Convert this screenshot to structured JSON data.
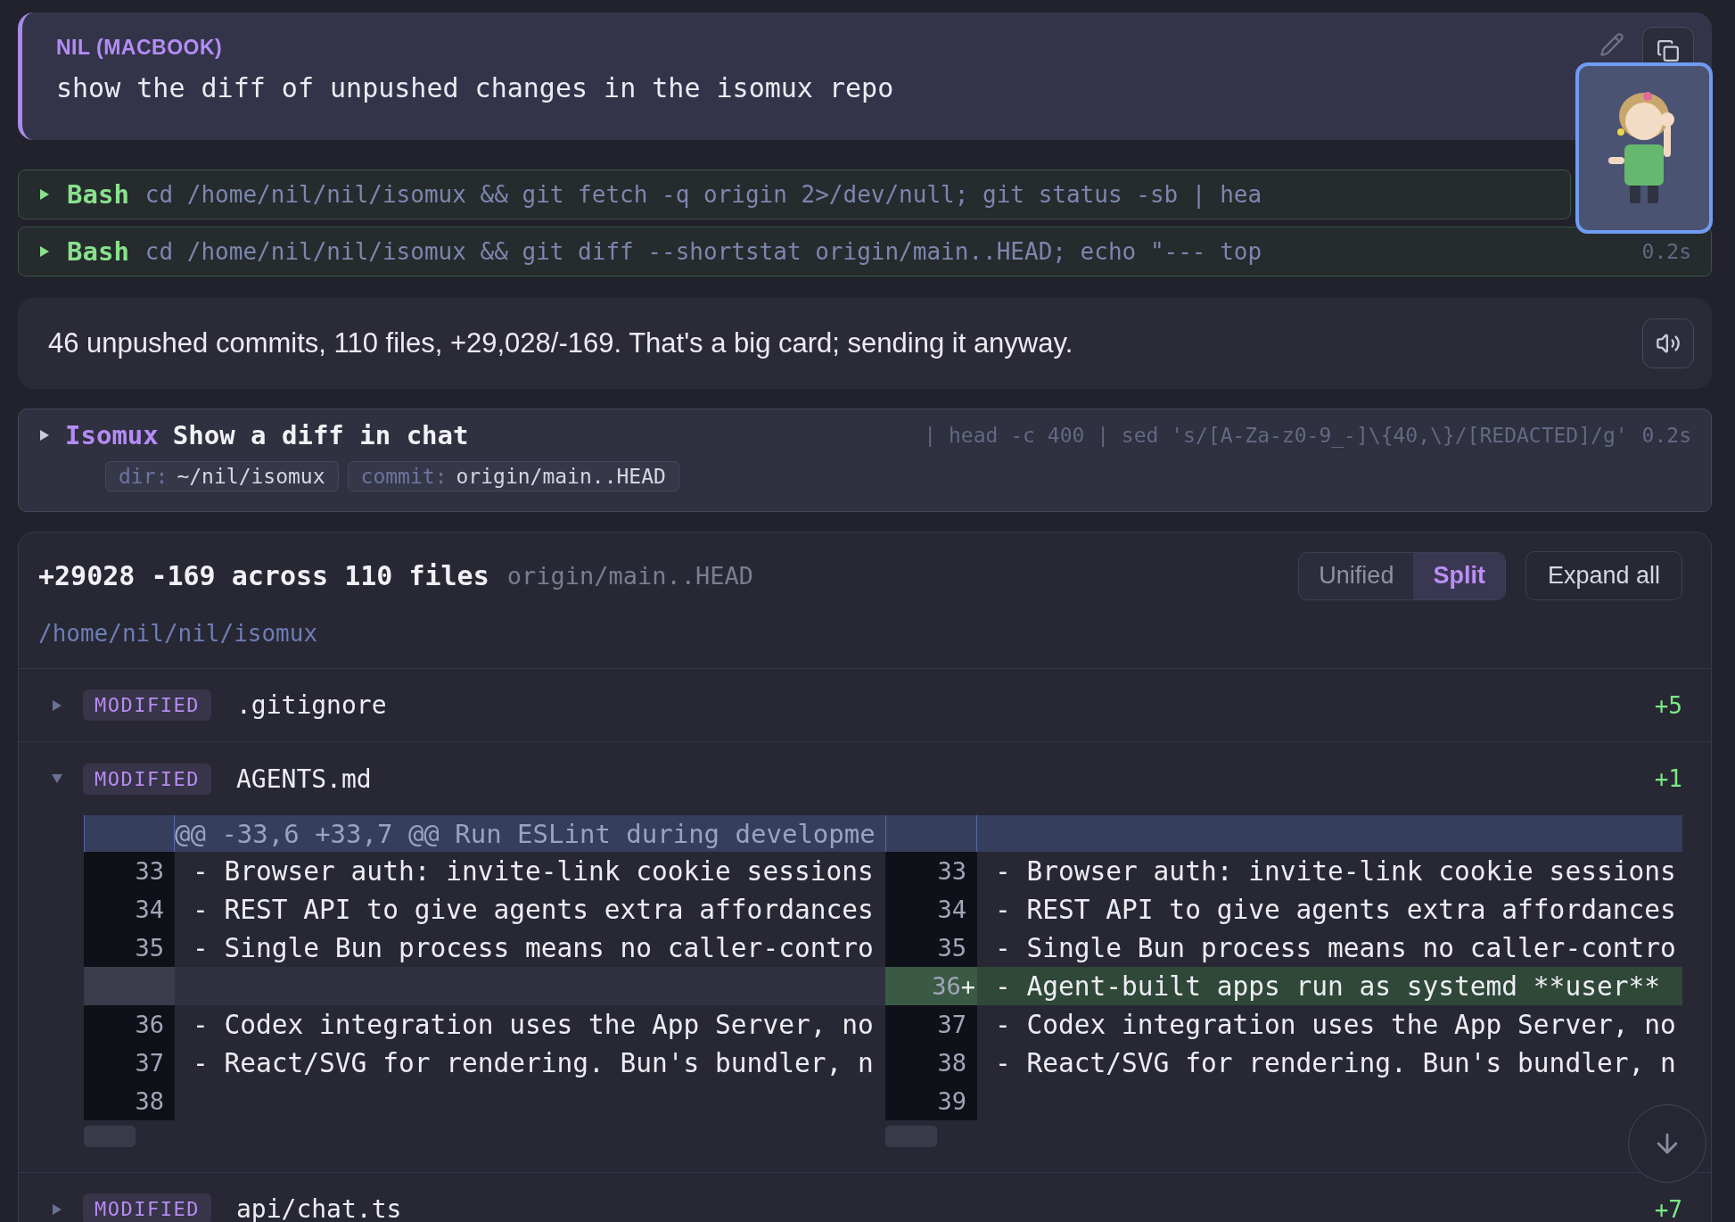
{
  "user_message": {
    "author": "NIL (MACBOOK)",
    "text": "show the diff of unpushed changes in the isomux repo"
  },
  "tool_calls": [
    {
      "tool": "Bash",
      "command": "cd /home/nil/nil/isomux && git fetch -q origin 2>/dev/null; git status -sb | hea"
    },
    {
      "tool": "Bash",
      "command": "cd /home/nil/nil/isomux && git diff --shortstat origin/main..HEAD; echo \"--- top",
      "duration": "0.2s"
    }
  ],
  "assistant_message": {
    "text": "46 unpushed commits, 110 files, +29,028/-169. That's a big card; sending it anyway."
  },
  "isomux_call": {
    "tool": "Isomux",
    "title": "Show a diff in chat",
    "command_tail": "| head -c 400 | sed 's/[A-Za-z0-9_-]\\{40,\\}/[REDACTED]/g'",
    "duration": "0.2s",
    "params": [
      {
        "key": "dir:",
        "value": "~/nil/isomux"
      },
      {
        "key": "commit:",
        "value": "origin/main..HEAD"
      }
    ]
  },
  "diff_card": {
    "stats": "+29028 -169 across 110 files",
    "range": "origin/main..HEAD",
    "path": "/home/nil/nil/isomux",
    "view_modes": [
      {
        "label": "Unified",
        "selected": false
      },
      {
        "label": "Split",
        "selected": true
      }
    ],
    "expand_button": "Expand all",
    "files": [
      {
        "status": "MODIFIED",
        "name": ".gitignore",
        "additions": "+5",
        "expanded": false
      },
      {
        "status": "MODIFIED",
        "name": "AGENTS.md",
        "additions": "+1",
        "expanded": true,
        "hunk": {
          "header": "@@ -33,6 +33,7 @@ Run ESLint during developme",
          "rows": [
            {
              "kind": "context",
              "left_number": "33",
              "left_text": "- Browser auth: invite-link cookie sessions",
              "right_number": "33",
              "right_text": "- Browser auth: invite-link cookie sessions"
            },
            {
              "kind": "context",
              "left_number": "34",
              "left_text": "- REST API to give agents extra affordances",
              "right_number": "34",
              "right_text": "- REST API to give agents extra affordances"
            },
            {
              "kind": "context",
              "left_number": "35",
              "left_text": "- Single Bun process means no caller-contro",
              "right_number": "35",
              "right_text": "- Single Bun process means no caller-contro"
            },
            {
              "kind": "added",
              "right_number": "36",
              "right_marker": "+",
              "right_text": "- Agent-built apps run as systemd **user**"
            },
            {
              "kind": "context",
              "left_number": "36",
              "left_text": "- Codex integration uses the App Server, no",
              "right_number": "37",
              "right_text": "- Codex integration uses the App Server, no"
            },
            {
              "kind": "context",
              "left_number": "37",
              "left_text": "- React/SVG for rendering. Bun's bundler, n",
              "right_number": "38",
              "right_text": "- React/SVG for rendering. Bun's bundler, n"
            },
            {
              "kind": "context",
              "left_number": "38",
              "right_number": "39"
            }
          ]
        }
      },
      {
        "status": "MODIFIED",
        "name": "api/chat.ts",
        "additions": "+7",
        "expanded": false
      }
    ]
  }
}
